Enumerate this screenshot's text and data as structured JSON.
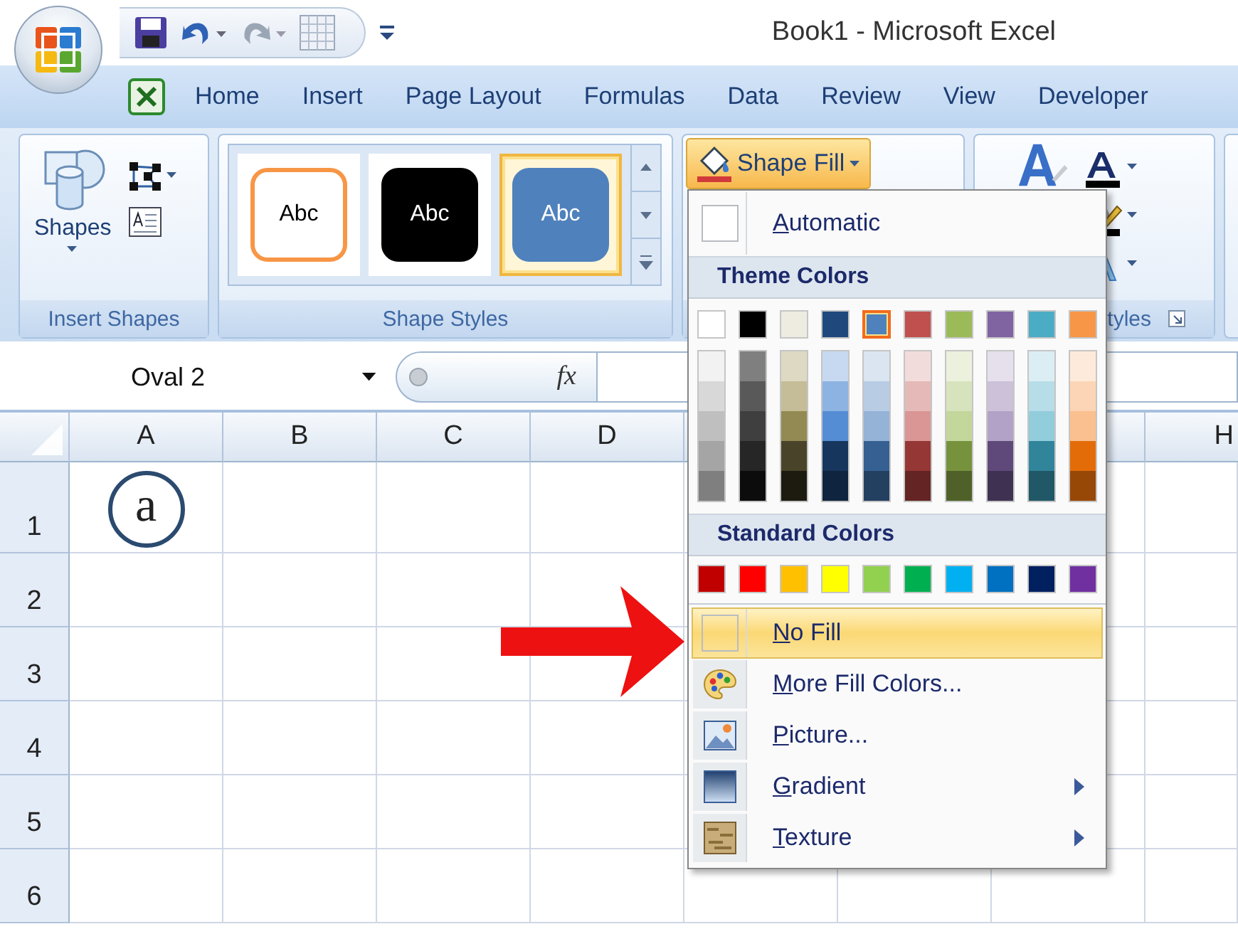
{
  "window": {
    "title": "Book1 - Microsoft Excel"
  },
  "quick_access_toolbar": [
    {
      "kind": "save",
      "disabled": false
    },
    {
      "kind": "undo",
      "disabled": false
    },
    {
      "kind": "redo",
      "disabled": true
    },
    {
      "kind": "grid",
      "disabled": false
    }
  ],
  "ribbon_tabs": [
    {
      "label": "Home"
    },
    {
      "label": "Insert"
    },
    {
      "label": "Page Layout"
    },
    {
      "label": "Formulas"
    },
    {
      "label": "Data"
    },
    {
      "label": "Review"
    },
    {
      "label": "View"
    },
    {
      "label": "Developer"
    }
  ],
  "ribbon_groups": [
    {
      "kind": "insert_shapes",
      "label": "Insert Shapes",
      "button_label": "Shapes"
    },
    {
      "kind": "shape_styles",
      "label": "Shape Styles",
      "styles": [
        {
          "label": "Abc",
          "kind": "outline",
          "color": "#f79646",
          "selected": false
        },
        {
          "label": "Abc",
          "kind": "filled",
          "color": "#000000",
          "selected": false
        },
        {
          "label": "Abc",
          "kind": "filled",
          "color": "#4f81bd",
          "selected": true
        }
      ]
    },
    {
      "kind": "shape_fill",
      "button_label": "Shape Fill",
      "pressed": true
    },
    {
      "kind": "wordart",
      "label": "tyles"
    }
  ],
  "formula_bar": {
    "name_box": "Oval 2",
    "fx_label": "fx"
  },
  "sheet": {
    "columns": [
      "A",
      "B",
      "C",
      "D",
      "H"
    ],
    "rows": [
      "1",
      "2",
      "3",
      "4",
      "5",
      "6"
    ],
    "shape": {
      "text": "a"
    }
  },
  "fill_menu": {
    "sections": [
      {
        "kind": "option",
        "label": "Automatic",
        "submenu": false,
        "selected": false
      },
      {
        "kind": "header",
        "label": "Theme Colors"
      },
      {
        "kind": "theme_palette",
        "columns": [
          {
            "color": "#ffffff",
            "selected": false,
            "shades": [
              {
                "color": "#f2f2f2"
              },
              {
                "color": "#d8d8d8"
              },
              {
                "color": "#bfbfbf"
              },
              {
                "color": "#a5a5a5"
              },
              {
                "color": "#7f7f7f"
              }
            ]
          },
          {
            "color": "#000000",
            "selected": false,
            "shades": [
              {
                "color": "#7f7f7f"
              },
              {
                "color": "#595959"
              },
              {
                "color": "#3f3f3f"
              },
              {
                "color": "#262626"
              },
              {
                "color": "#0c0c0c"
              }
            ]
          },
          {
            "color": "#eeece1",
            "selected": false,
            "shades": [
              {
                "color": "#ddd9c3"
              },
              {
                "color": "#c4bd97"
              },
              {
                "color": "#938953"
              },
              {
                "color": "#494429"
              },
              {
                "color": "#1d1b10"
              }
            ]
          },
          {
            "color": "#1f497d",
            "selected": false,
            "shades": [
              {
                "color": "#c6d9f0"
              },
              {
                "color": "#8db3e2"
              },
              {
                "color": "#548dd4"
              },
              {
                "color": "#17365d"
              },
              {
                "color": "#0f243e"
              }
            ]
          },
          {
            "color": "#4f81bd",
            "selected": true,
            "shades": [
              {
                "color": "#dbe5f1"
              },
              {
                "color": "#b8cce4"
              },
              {
                "color": "#95b3d7"
              },
              {
                "color": "#366092"
              },
              {
                "color": "#244061"
              }
            ]
          },
          {
            "color": "#c0504d",
            "selected": false,
            "shades": [
              {
                "color": "#f2dcdb"
              },
              {
                "color": "#e5b9b7"
              },
              {
                "color": "#d99694"
              },
              {
                "color": "#953734"
              },
              {
                "color": "#632423"
              }
            ]
          },
          {
            "color": "#9bbb59",
            "selected": false,
            "shades": [
              {
                "color": "#ebf1dd"
              },
              {
                "color": "#d7e3bc"
              },
              {
                "color": "#c3d69b"
              },
              {
                "color": "#76923c"
              },
              {
                "color": "#4f6128"
              }
            ]
          },
          {
            "color": "#8064a2",
            "selected": false,
            "shades": [
              {
                "color": "#e5e0ec"
              },
              {
                "color": "#ccc1d9"
              },
              {
                "color": "#b2a2c7"
              },
              {
                "color": "#5f497a"
              },
              {
                "color": "#3f3151"
              }
            ]
          },
          {
            "color": "#4bacc6",
            "selected": false,
            "shades": [
              {
                "color": "#dbeef3"
              },
              {
                "color": "#b7dde8"
              },
              {
                "color": "#92cddc"
              },
              {
                "color": "#31859b"
              },
              {
                "color": "#205867"
              }
            ]
          },
          {
            "color": "#f79646",
            "selected": false,
            "shades": [
              {
                "color": "#fdeada"
              },
              {
                "color": "#fbd5b5"
              },
              {
                "color": "#fac08f"
              },
              {
                "color": "#e36c09"
              },
              {
                "color": "#974806"
              }
            ]
          }
        ]
      },
      {
        "kind": "header",
        "label": "Standard Colors"
      },
      {
        "kind": "standard_palette",
        "colors": [
          {
            "color": "#c00000"
          },
          {
            "color": "#ff0000"
          },
          {
            "color": "#ffc000"
          },
          {
            "color": "#ffff00"
          },
          {
            "color": "#92d050"
          },
          {
            "color": "#00b050"
          },
          {
            "color": "#00b0f0"
          },
          {
            "color": "#0070c0"
          },
          {
            "color": "#002060"
          },
          {
            "color": "#7030a0"
          }
        ]
      },
      {
        "kind": "option",
        "label": "No Fill",
        "submenu": false,
        "selected": true
      },
      {
        "kind": "option",
        "label": "More Fill Colors...",
        "submenu": false,
        "selected": false
      },
      {
        "kind": "option",
        "label": "Picture...",
        "submenu": false,
        "selected": false
      },
      {
        "kind": "option",
        "label": "Gradient",
        "submenu": true,
        "selected": false
      },
      {
        "kind": "option",
        "label": "Texture",
        "submenu": true,
        "selected": false
      }
    ]
  }
}
